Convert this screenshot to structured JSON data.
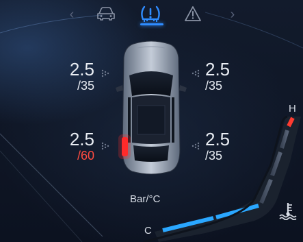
{
  "nav": {
    "tabs": [
      {
        "icon": "car-icon",
        "active": false
      },
      {
        "icon": "tire-pressure-icon",
        "active": true
      },
      {
        "icon": "warning-triangle-icon",
        "active": false
      }
    ],
    "prev_icon": "chevron-left-icon",
    "next_icon": "chevron-right-icon",
    "accent_color": "#2f8cff"
  },
  "tires": {
    "front_left": {
      "pressure": "2.5",
      "temp": "/35"
    },
    "front_right": {
      "pressure": "2.5",
      "temp": "/35"
    },
    "rear_left": {
      "pressure": "2.5",
      "temp": "/60",
      "temp_warning": true
    },
    "rear_right": {
      "pressure": "2.5",
      "temp": "/35"
    }
  },
  "units": "Bar/°C",
  "temp_gauge": {
    "high_label": "H",
    "low_label": "C",
    "icon": "coolant-temperature-icon",
    "low_color": "#2aa7ff",
    "high_color": "#ff3b30"
  },
  "colors": {
    "warning": "#ff4b40",
    "rear_light": "#ff2a2a"
  }
}
